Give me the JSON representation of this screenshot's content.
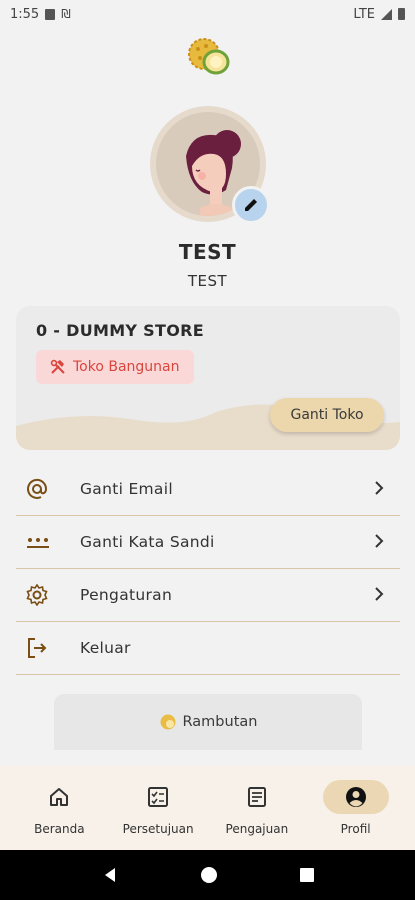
{
  "status_bar": {
    "time": "1:55",
    "network": "LTE"
  },
  "profile": {
    "name": "TEST",
    "subtitle": "TEST"
  },
  "store": {
    "name": "0 - DUMMY STORE",
    "category": "Toko Bangunan",
    "change_button": "Ganti Toko"
  },
  "menu": {
    "items": [
      {
        "label": "Ganti Email",
        "icon": "at-icon"
      },
      {
        "label": "Ganti Kata Sandi",
        "icon": "password-icon"
      },
      {
        "label": "Pengaturan",
        "icon": "gear-icon"
      },
      {
        "label": "Keluar",
        "icon": "logout-icon"
      }
    ]
  },
  "secondary": {
    "rambutan_label": "Rambutan"
  },
  "bottom_nav": {
    "items": [
      {
        "label": "Beranda",
        "icon": "home-icon"
      },
      {
        "label": "Persetujuan",
        "icon": "approval-icon"
      },
      {
        "label": "Pengajuan",
        "icon": "document-icon"
      },
      {
        "label": "Profil",
        "icon": "profile-icon"
      }
    ],
    "active": "Profil"
  },
  "colors": {
    "accent": "#ebd7b4",
    "badge_bg": "#fbd8d8",
    "badge_text": "#d8463e",
    "icon_brown": "#7a4f16"
  }
}
